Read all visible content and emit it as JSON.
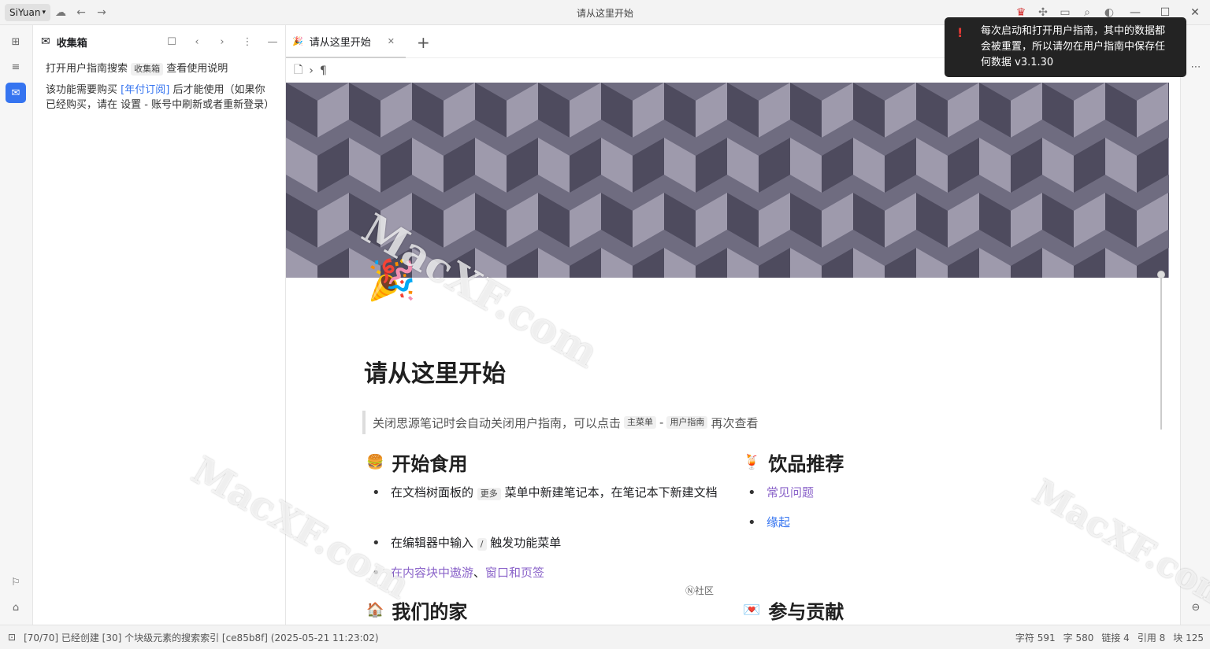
{
  "topbar": {
    "workspace": "SiYuan",
    "window_title": "请从这里开始",
    "icons": [
      "sync-icon",
      "back-icon",
      "forward-icon",
      "vip-icon",
      "plugin-icon",
      "terminal-icon",
      "search-icon",
      "theme-icon"
    ]
  },
  "left_dock": {
    "icons": [
      "file-tree-icon",
      "outline-icon",
      "inbox-icon",
      "bookmark-icon",
      "tag-icon"
    ]
  },
  "inbox_panel": {
    "title": "收集箱",
    "line1_prefix": "打开用户指南搜索",
    "line1_kbd": "收集箱",
    "line1_suffix": "查看使用说明",
    "line2_prefix": "该功能需要购买",
    "line2_link": "[年付订阅]",
    "line2_suffix": "后才能使用（如果你已经购买，请在 设置 - 账号中刷新或者重新登录）"
  },
  "tabs": [
    {
      "label": "请从这里开始",
      "emoji": "🎉"
    }
  ],
  "breadcrumb": {
    "paragraph_symbol": "¶"
  },
  "document": {
    "icon": "🎉",
    "title": "请从这里开始",
    "quote": {
      "prefix": "关闭思源笔记时会自动关闭用户指南，可以点击",
      "kbd1": "主菜单",
      "sep": "-",
      "kbd2": "用户指南",
      "suffix": "再次查看"
    },
    "section1": {
      "emoji": "🍔",
      "heading": "开始食用"
    },
    "item1_prefix": "在文档树面板的",
    "item1_kbd": "更多",
    "item1_suffix": "菜单中新建笔记本，在笔记本下新建文档",
    "item2_prefix": "在编辑器中输入",
    "item2_kbd": "/",
    "item2_suffix": "触发功能菜单",
    "item3_link1": "在内容块中遨游",
    "item3_sep": "、",
    "item3_link2": "窗口和页签",
    "section2": {
      "emoji": "🍹",
      "heading": "饮品推荐"
    },
    "drink1": "常见问题",
    "drink2": "缘起",
    "community": "Ⓝ社区",
    "section3": {
      "emoji": "🏠",
      "heading": "我们的家"
    },
    "section4": {
      "emoji": "💌",
      "heading": "参与贡献"
    }
  },
  "toast": {
    "text": "每次启动和打开用户指南，其中的数据都会被重置，所以请勿在用户指南中保存任何数据 v3.1.30"
  },
  "statusbar": {
    "message": "[70/70] 已经创建 [30] 个块级元素的搜索索引 [ce85b8f] (2025-05-21 11:23:02)",
    "chars": "字符 591",
    "words": "字 580",
    "links": "链接 4",
    "refs": "引用 8",
    "blocks": "块 125"
  },
  "watermark": "MacXF.com",
  "colors": {
    "accent": "#3574f0",
    "link_purple": "#8a63c9",
    "toast_bg": "#232323",
    "cube_light": "#9e9aac",
    "cube_mid": "#6f6c80",
    "cube_dark": "#4e4b5e"
  }
}
